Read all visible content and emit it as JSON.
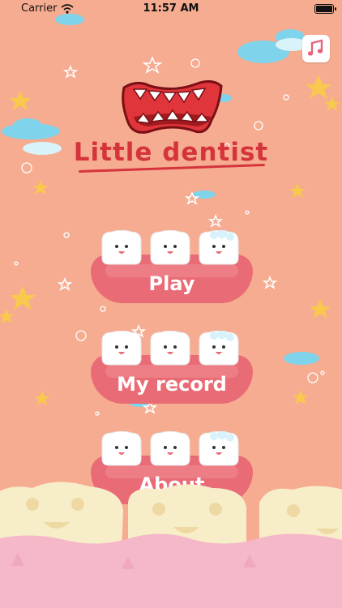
{
  "status_bar": {
    "carrier": "Carrier",
    "time": "11:57 AM"
  },
  "header": {
    "title": "Little dentist"
  },
  "menu": [
    {
      "label": "Play"
    },
    {
      "label": "My record"
    },
    {
      "label": "About"
    }
  ],
  "icons": {
    "music": "music-note-icon",
    "wifi": "wifi-icon",
    "battery": "battery-icon"
  },
  "colors": {
    "background": "#F6AC91",
    "title": "#D5343C",
    "gum": "#E96B75",
    "tooth": "#FFFFFF",
    "bottom_gum": "#F4B8C8",
    "bottom_tooth": "#F8EDC9"
  }
}
